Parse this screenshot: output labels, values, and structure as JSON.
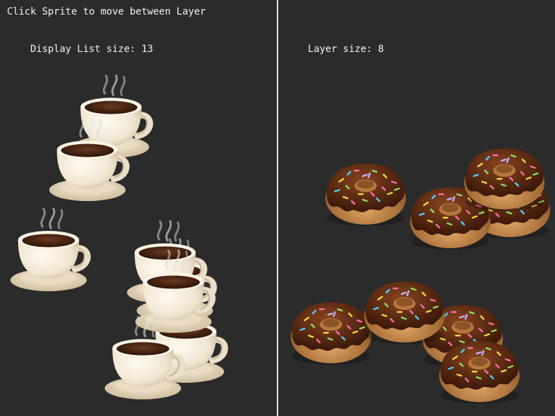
{
  "left_panel": {
    "instruction_label": "Click Sprite to move between Layer",
    "display_list_label": "Display List size:",
    "display_list_size": "13"
  },
  "right_panel": {
    "layer_label": "Layer size:",
    "layer_size": "8"
  },
  "sprites": {
    "coffee_cup_icon": "coffee-cup-icon",
    "donut_icon": "chocolate-donut-icon"
  },
  "colors": {
    "background": "#2b2b2b",
    "divider": "#e6e6e6",
    "text": "#f2f2f2",
    "cup_body": "#f4ede0",
    "coffee": "#4a2515",
    "saucer": "#e8dcc4",
    "donut_dough": "#c98a4b",
    "chocolate_glaze": "#5a2a12"
  }
}
